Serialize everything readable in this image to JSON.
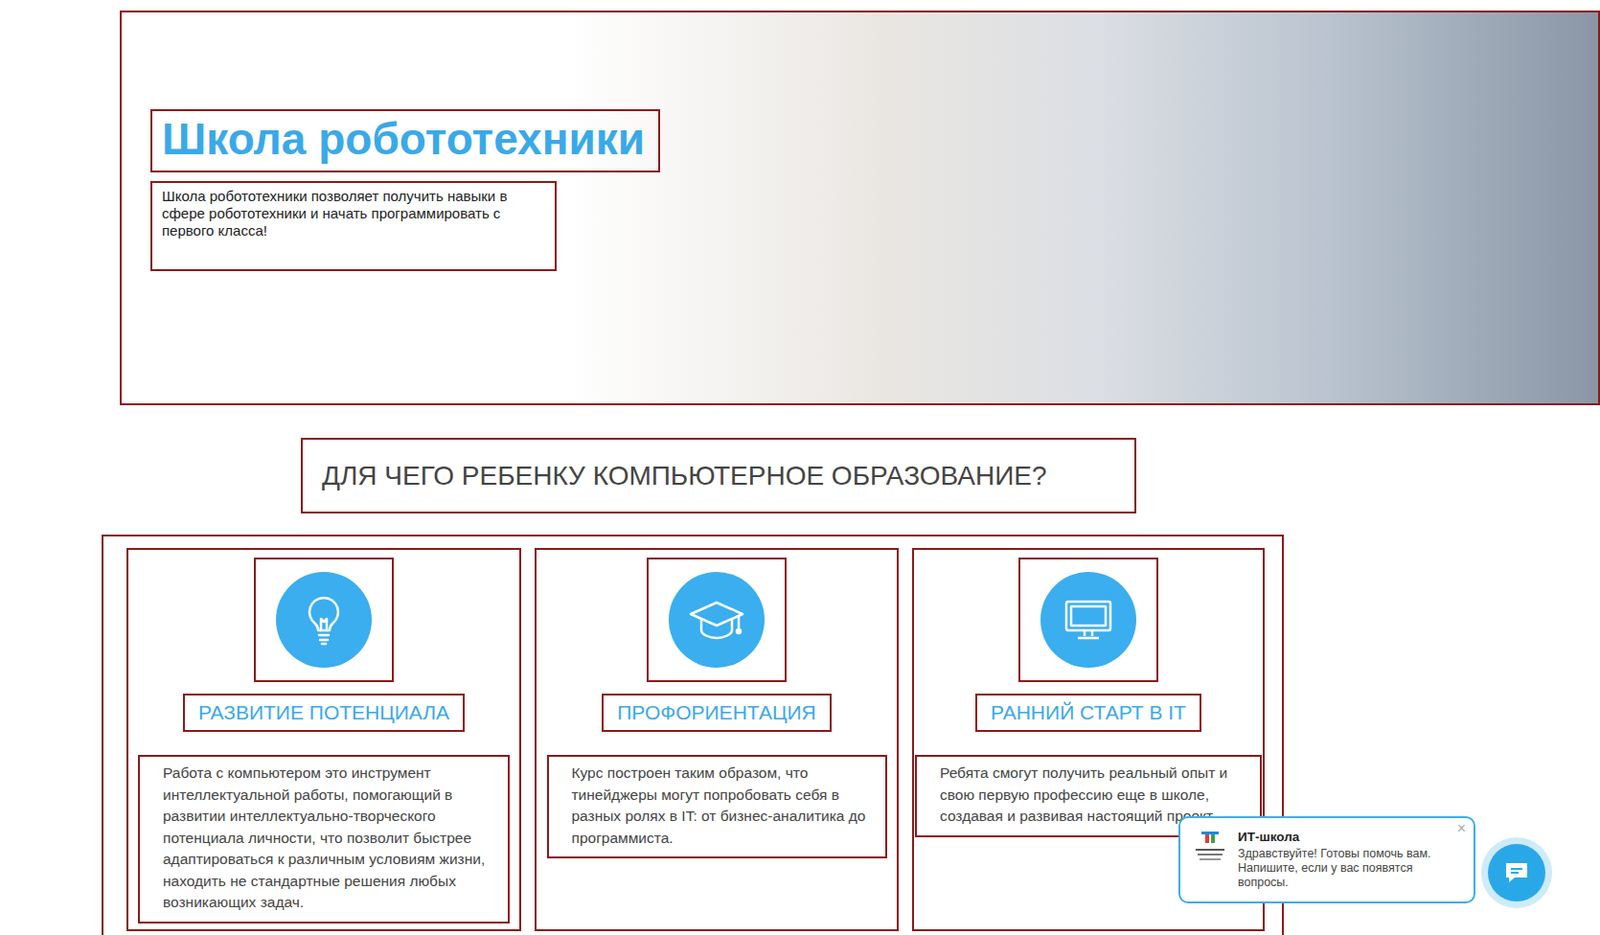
{
  "hero": {
    "title": "Школа робототехники",
    "description": "Школа робототехники позволяет получить навыки в сфере робототехники и начать программировать с первого класса!"
  },
  "section": {
    "heading": "ДЛЯ ЧЕГО РЕБЕНКУ КОМПЬЮТЕРНОЕ ОБРАЗОВАНИЕ?"
  },
  "cards": [
    {
      "kind": "lightbulb",
      "title": "РАЗВИТИЕ ПОТЕНЦИАЛА",
      "text": "Работа с компьютером это инструмент интеллектуальной работы, помогающий в развитии интеллектуально-творческого потенциала личности, что позволит быстрее адаптироваться к различным условиям жизни, находить не стандартные решения любых возникающих задач."
    },
    {
      "kind": "graduation",
      "title": "ПРОФОРИЕНТАЦИЯ",
      "text": "Курс построен таким образом, что тинейджеры могут попробовать себя в разных ролях в IT: от бизнес-аналитика до программиста."
    },
    {
      "kind": "monitor",
      "title": "РАННИЙ СТАРТ В IT",
      "text": "Ребята смогут получить реальный опыт и свою первую профессию еще в школе, создавая и развивая настоящий проект."
    }
  ],
  "chat": {
    "title": "ИТ-школа",
    "message": "Здравствуйте! Готовы помочь вам. Напишите, если у вас появятся вопросы.",
    "close": "×"
  }
}
